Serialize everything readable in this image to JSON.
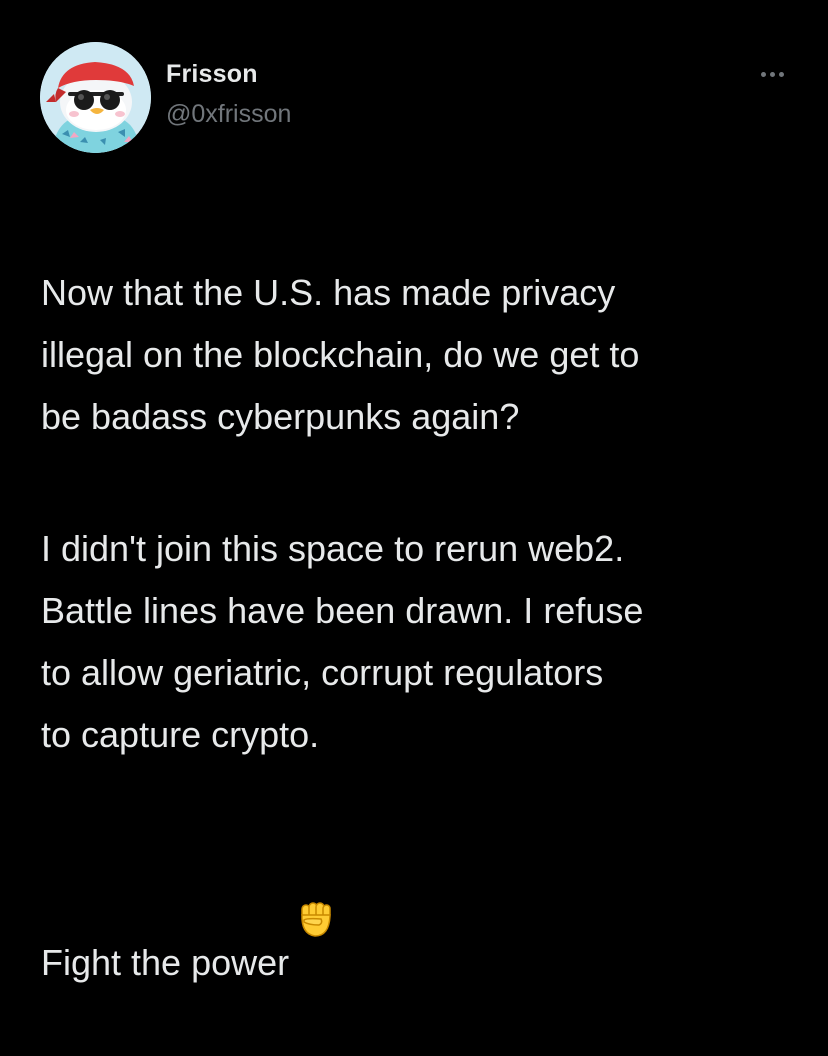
{
  "tweet": {
    "author": {
      "display_name": "Frisson",
      "handle": "@0xfrisson",
      "avatar_icon": "penguin-avatar-icon"
    },
    "more_icon": "more-options-icon",
    "paragraphs": [
      "Now that the U.S. has made privacy\nillegal on the blockchain, do we get to\nbe badass cyberpunks again?",
      "I didn't join this space to rerun web2.\nBattle lines have been drawn. I refuse\nto allow geriatric, corrupt regulators\nto capture crypto.",
      "Fight the power"
    ],
    "emoji": {
      "name": "raised-fist-icon",
      "glyph": "✊"
    }
  },
  "colors": {
    "background": "#000000",
    "text_primary": "#e7e9ea",
    "text_secondary": "#71767b"
  }
}
